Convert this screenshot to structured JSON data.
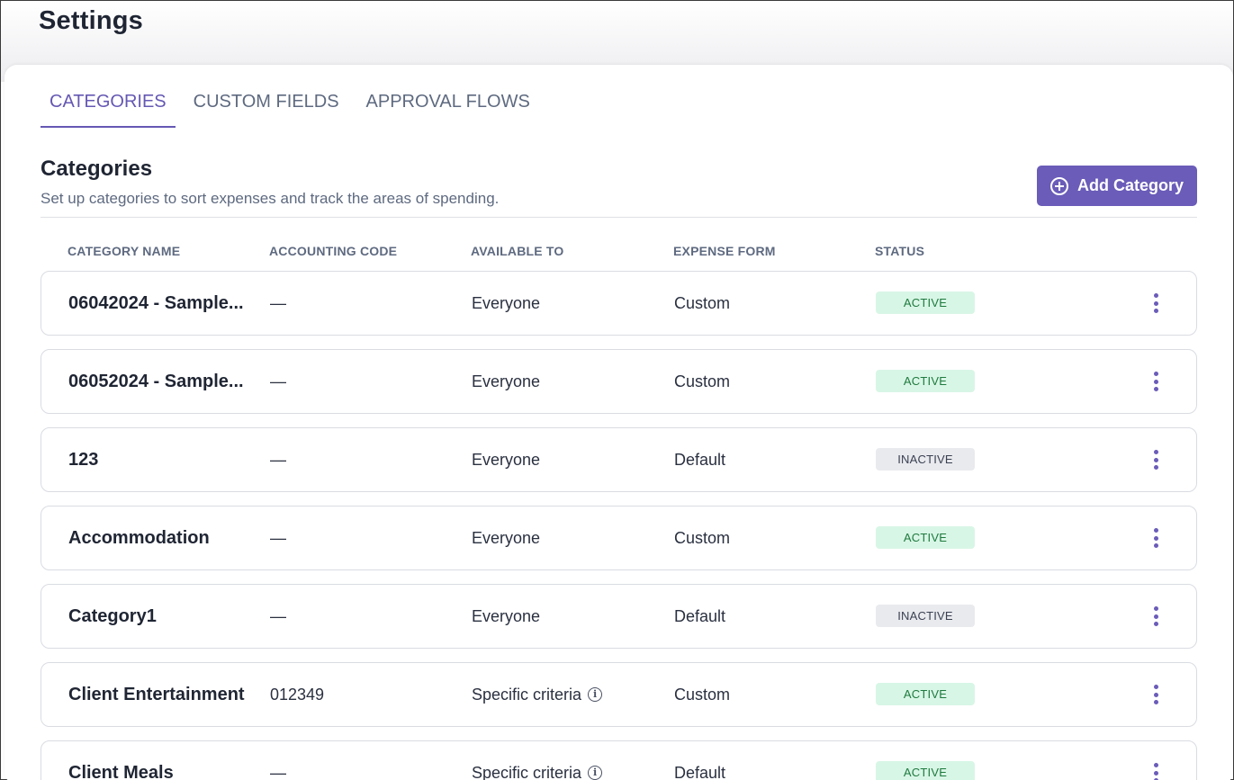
{
  "page": {
    "title": "Settings"
  },
  "tabs": [
    {
      "label": "CATEGORIES",
      "active": true
    },
    {
      "label": "CUSTOM FIELDS",
      "active": false
    },
    {
      "label": "APPROVAL FLOWS",
      "active": false
    }
  ],
  "section": {
    "title": "Categories",
    "description": "Set up categories to sort expenses and track the areas of spending.",
    "add_button": "Add Category",
    "add_icon": "plus-circle-icon"
  },
  "table": {
    "headers": [
      "CATEGORY NAME",
      "ACCOUNTING CODE",
      "AVAILABLE TO",
      "EXPENSE FORM",
      "STATUS"
    ],
    "rows": [
      {
        "name": "06042024 - Sample...",
        "code": "—",
        "available": "Everyone",
        "info": false,
        "form": "Custom",
        "status": "ACTIVE"
      },
      {
        "name": "06052024 - Sample...",
        "code": "—",
        "available": "Everyone",
        "info": false,
        "form": "Custom",
        "status": "ACTIVE"
      },
      {
        "name": "123",
        "code": "—",
        "available": "Everyone",
        "info": false,
        "form": "Default",
        "status": "INACTIVE"
      },
      {
        "name": "Accommodation",
        "code": "—",
        "available": "Everyone",
        "info": false,
        "form": "Custom",
        "status": "ACTIVE"
      },
      {
        "name": "Category1",
        "code": "—",
        "available": "Everyone",
        "info": false,
        "form": "Default",
        "status": "INACTIVE"
      },
      {
        "name": "Client Entertainment",
        "code": "012349",
        "available": "Specific criteria",
        "info": true,
        "form": "Custom",
        "status": "ACTIVE"
      },
      {
        "name": "Client Meals",
        "code": "—",
        "available": "Specific criteria",
        "info": true,
        "form": "Default",
        "status": "ACTIVE"
      }
    ]
  },
  "colors": {
    "accent": "#6a5cb8",
    "active_bg": "#d8f6e6",
    "active_text": "#1f7a3f",
    "inactive_bg": "#e9eaee",
    "inactive_text": "#3a4152"
  }
}
